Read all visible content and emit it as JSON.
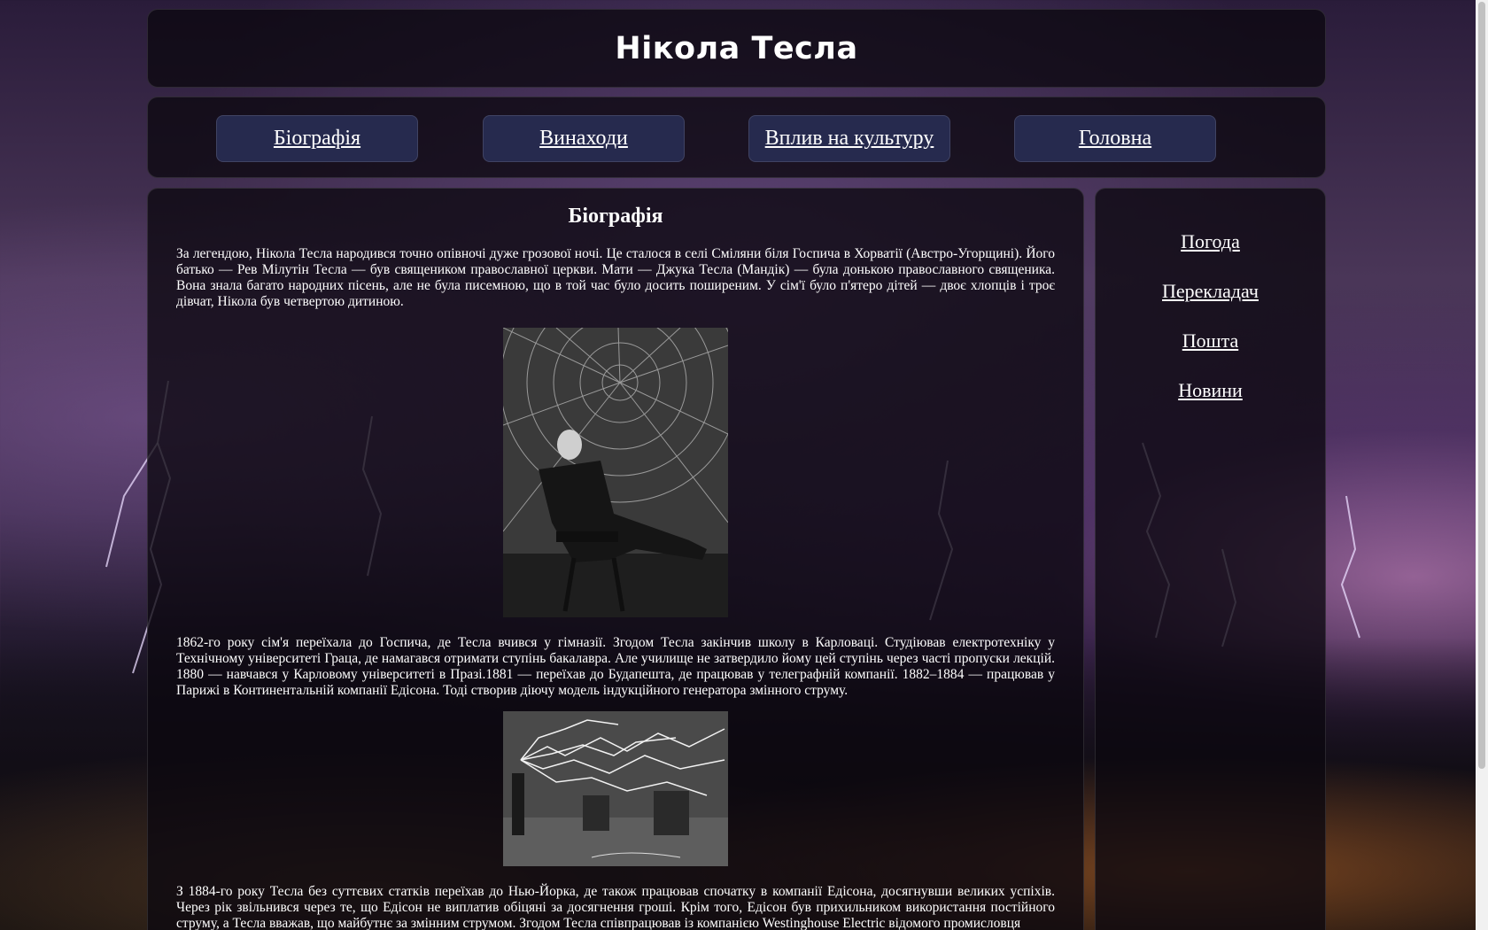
{
  "header": {
    "title": "Нікола Тесла"
  },
  "nav": {
    "items": [
      {
        "label": "Біографія"
      },
      {
        "label": "Винаходи"
      },
      {
        "label": "Вплив на культуру"
      },
      {
        "label": "Головна"
      }
    ]
  },
  "main": {
    "title": "Біографія",
    "paragraphs": [
      "За легендою, Нікола Тесла народився точно опівночі дуже грозової ночі. Це сталося в селі Сміляни біля Госпича в Хорватії (Австро-Угорщині). Його батько — Рев Мілутін Тесла — був священиком православної церкви. Мати — Джука Тесла (Мандік) — була донькою православного священика. Вона знала багато народних пісень, але не була писемною, що в той час було досить поширеним. У сім'ї було п'ятеро дітей — двоє хлопців і троє дівчат, Нікола був четвертою дитиною.",
      "1862-го року сім'я переїхала до Госпича, де Тесла вчився у гімназії. Згодом Тесла закінчив школу в Карловаці. Студіював електротехніку у Технічному університеті Граца, де намагався отримати ступінь бакалавра. Але училище не затвердило йому цей ступінь через часті пропуски лекцій. 1880 — навчався у Карловому університеті в Празі.1881 — переїхав до Будапешта, де працював у телеграфній компанії. 1882–1884 — працював у Парижі в Континентальній компанії Едісона. Тоді створив діючу модель індукційного генератора змінного струму.",
      "З 1884-го року Тесла без суттєвих статків переїхав до Нью-Йорка, де також працював спочатку в компанії Едісона, досягнувши великих успіхів. Через рік звільнився через те, що Едісон не виплатив обіцяні за досягнення гроші. Крім того, Едісон був прихильником використання постійного струму, а Тесла вважав, що майбутнє за змінним струмом. Згодом Тесла співпрацював із компанією Westinghouse Electric відомого промисловця"
    ]
  },
  "sidebar": {
    "links": [
      {
        "label": "Погода"
      },
      {
        "label": "Перекладач"
      },
      {
        "label": "Пошта"
      },
      {
        "label": "Новини"
      }
    ]
  }
}
